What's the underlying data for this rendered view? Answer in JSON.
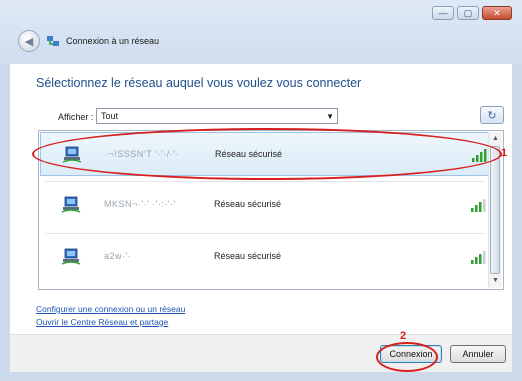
{
  "window": {
    "title": "Connexion à un réseau",
    "controls": {
      "minimize": "—",
      "maximize": "▢",
      "close": "✕"
    }
  },
  "heading": "Sélectionnez le réseau auquel vous voulez vous connecter",
  "filter": {
    "label": "Afficher :",
    "selected": "Tout",
    "arrow": "▼"
  },
  "refresh_glyph": "↻",
  "networks": [
    {
      "name": "·¬!SSSN‘T ‘·'·/·'·",
      "status": "Réseau sécurisé",
      "selected": true,
      "signal": 4
    },
    {
      "name": "MKSN¬·'·' ·'·:·'·'",
      "status": "Réseau sécurisé",
      "selected": false,
      "signal": 3
    },
    {
      "name": "a2w·'·",
      "status": "Réseau sécurisé",
      "selected": false,
      "signal": 3
    }
  ],
  "links": {
    "setup": "Configurer une connexion ou un réseau",
    "center": "Ouvrir le Centre Réseau et partage"
  },
  "buttons": {
    "connect": "Connexion",
    "cancel": "Annuler"
  },
  "annotations": {
    "one": "1",
    "two": "2"
  },
  "scroll": {
    "up": "▲",
    "down": "▼"
  },
  "colors": {
    "heading": "#1f4e8c",
    "annotation": "#d62020",
    "link": "#1f56b5",
    "signal": "#2fa12f"
  }
}
